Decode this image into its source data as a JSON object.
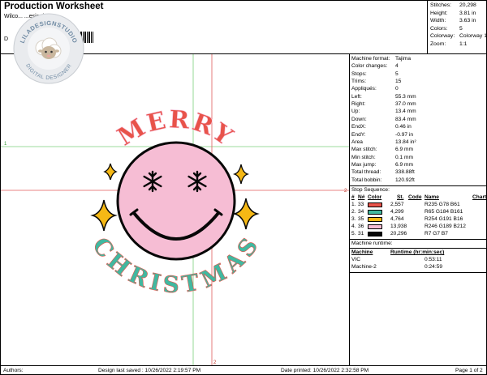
{
  "header": {
    "title": "Production Worksheet",
    "subtitle": "Wilco... ...esigning",
    "d_label": "D"
  },
  "logo": {
    "text": "LILADESIGNSTUDIO",
    "caption": "DIGITAL DESIGNER"
  },
  "stats": [
    {
      "label": "Stitches:",
      "value": "20,298"
    },
    {
      "label": "Height:",
      "value": "3.81 in"
    },
    {
      "label": "Width:",
      "value": "3.63 in"
    },
    {
      "label": "Colors:",
      "value": "5"
    },
    {
      "label": "Colorway:",
      "value": "Colorway 1"
    },
    {
      "label": "Zoom:",
      "value": "1:1"
    }
  ],
  "machine_info": [
    {
      "label": "Machine format:",
      "value": "Tajima"
    },
    {
      "label": "Color changes:",
      "value": "4"
    },
    {
      "label": "Stops:",
      "value": "5"
    },
    {
      "label": "Trims:",
      "value": "15"
    },
    {
      "label": "Appliqués:",
      "value": "0"
    },
    {
      "label": "Left:",
      "value": "55.3 mm"
    },
    {
      "label": "Right:",
      "value": "37.0 mm"
    },
    {
      "label": "Up:",
      "value": "13.4 mm"
    },
    {
      "label": "Down:",
      "value": "83.4 mm"
    },
    {
      "label": "EndX:",
      "value": "0.46 in"
    },
    {
      "label": "EndY:",
      "value": "-0.97 in"
    },
    {
      "label": "Area",
      "value": "13.84 in²"
    },
    {
      "label": "Max stitch:",
      "value": "6.9 mm"
    },
    {
      "label": "Min stitch:",
      "value": "0.1 mm"
    },
    {
      "label": "Max jump:",
      "value": "6.9 mm"
    },
    {
      "label": "Total thread:",
      "value": "338.88ft"
    },
    {
      "label": "Total bobbin:",
      "value": "120.92ft"
    }
  ],
  "stop_sequence": {
    "title": "Stop Sequence:",
    "headers": {
      "num": "#",
      "n": "N#",
      "color": "Color",
      "st": "St.",
      "code": "Code",
      "name": "Name",
      "chart": "Chart"
    },
    "rows": [
      {
        "num": "1.",
        "n": "33",
        "color": "#e8534a",
        "st": "2,557",
        "code": "",
        "name": "R235 G78 B61"
      },
      {
        "num": "2.",
        "n": "34",
        "color": "#41b8a0",
        "st": "4,299",
        "code": "",
        "name": "R65 G184 B161"
      },
      {
        "num": "3.",
        "n": "35",
        "color": "#f5b815",
        "st": "4,764",
        "code": "",
        "name": "R254 G191 B16"
      },
      {
        "num": "4.",
        "n": "36",
        "color": "#f6bdd4",
        "st": "13,938",
        "code": "",
        "name": "R246 G189 B212"
      },
      {
        "num": "5.",
        "n": "31",
        "color": "#070707",
        "st": "20,296",
        "code": "",
        "name": "R7 G7 B7"
      }
    ]
  },
  "runtime": {
    "title": "Machine runtime:",
    "headers": {
      "machine": "Machine",
      "runtime": "Runtime (hr:min:sec)"
    },
    "rows": [
      {
        "machine": "VIC",
        "runtime": "0:53:11"
      },
      {
        "machine": "Machine-2",
        "runtime": "0:24:59"
      }
    ]
  },
  "design": {
    "top_text": "MERRY",
    "bottom_text": "CHRISTMAS",
    "marker_1": "1",
    "marker_2": "2",
    "colors": {
      "pink": "#f6bdd4",
      "red": "#e8534a",
      "teal": "#41b8a0",
      "yellow": "#f5b815",
      "black": "#070707",
      "guide_green": "#7ccf7c",
      "guide_red": "#e05a5a"
    }
  },
  "footer": {
    "authors": "Authors:",
    "saved": "Design last saved : 10/26/2022 2:19:57 PM",
    "printed": "Date printed: 10/26/2022 2:32:58 PM",
    "page": "Page 1 of 2"
  }
}
